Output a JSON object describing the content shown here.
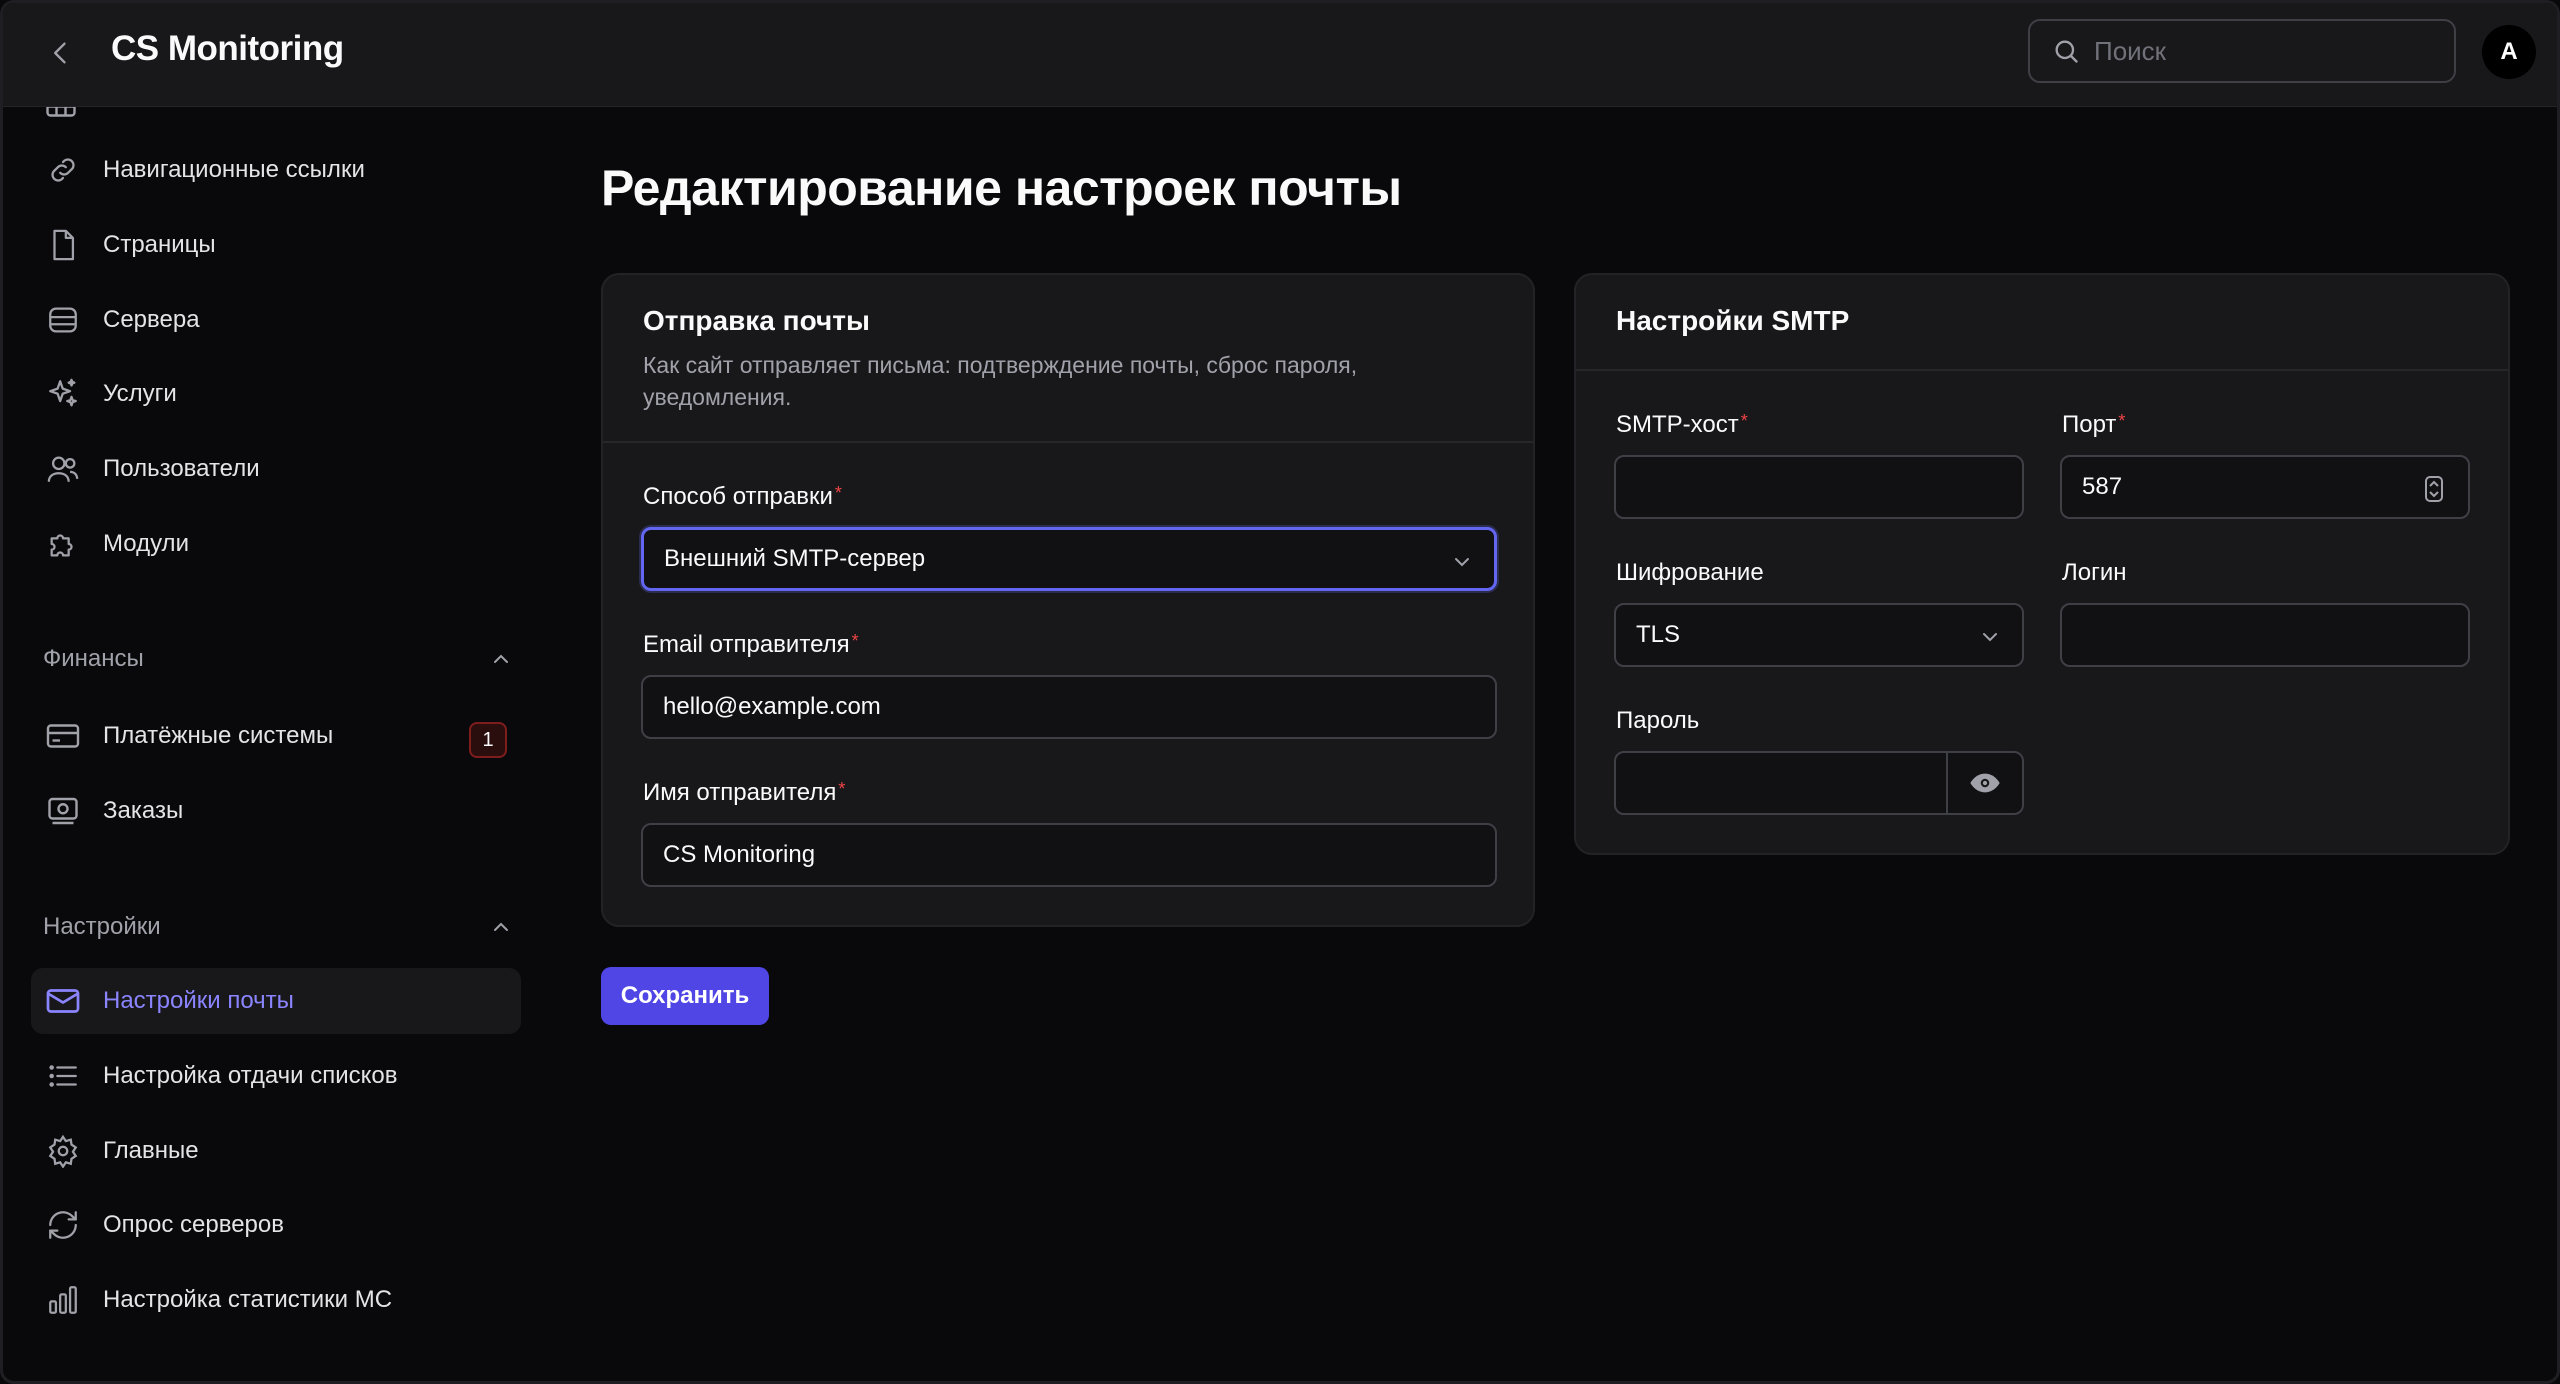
{
  "header": {
    "title": "CS Monitoring",
    "search_placeholder": "Поиск",
    "avatar_initial": "A"
  },
  "sidebar": {
    "items_top": [
      {
        "label": "Навигационные ссылки",
        "icon": "link-icon"
      },
      {
        "label": "Страницы",
        "icon": "file-icon"
      },
      {
        "label": "Сервера",
        "icon": "server-icon"
      },
      {
        "label": "Услуги",
        "icon": "sparkles-icon"
      },
      {
        "label": "Пользователи",
        "icon": "users-icon"
      },
      {
        "label": "Модули",
        "icon": "puzzle-icon"
      }
    ],
    "finance_section": "Финансы",
    "finance_items": [
      {
        "label": "Платёжные системы",
        "icon": "credit-card-icon",
        "badge": "1"
      },
      {
        "label": "Заказы",
        "icon": "orders-icon"
      }
    ],
    "settings_section": "Настройки",
    "settings_items": [
      {
        "label": "Настройки почты",
        "icon": "mail-icon",
        "active": true
      },
      {
        "label": "Настройка отдачи списков",
        "icon": "list-icon"
      },
      {
        "label": "Главные",
        "icon": "gear-icon"
      },
      {
        "label": "Опрос серверов",
        "icon": "refresh-icon"
      },
      {
        "label": "Настройка статистики МС",
        "icon": "bar-chart-icon"
      }
    ]
  },
  "main": {
    "page_title": "Редактирование настроек почты",
    "mail_card": {
      "title": "Отправка почты",
      "description": "Как сайт отправляет письма: подтверждение почты, сброс пароля, уведомления.",
      "method_label": "Способ отправки",
      "method_value": "Внешний SMTP-сервер",
      "sender_email_label": "Email отправителя",
      "sender_email_value": "hello@example.com",
      "sender_name_label": "Имя отправителя",
      "sender_name_value": "CS Monitoring"
    },
    "smtp_card": {
      "title": "Настройки SMTP",
      "host_label": "SMTP-хост",
      "host_value": "",
      "port_label": "Порт",
      "port_value": "587",
      "encryption_label": "Шифрование",
      "encryption_value": "TLS",
      "login_label": "Логин",
      "login_value": "",
      "password_label": "Пароль",
      "password_value": ""
    },
    "save_label": "Сохранить"
  },
  "colors": {
    "accent": "#4f46e5",
    "active_text": "#8b84ff",
    "required": "#ef4444"
  }
}
